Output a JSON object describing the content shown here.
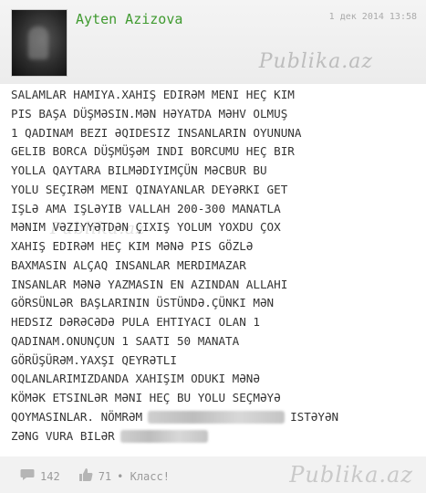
{
  "post": {
    "author": "Ayten Azizova",
    "date": "1 дек 2014 13:58",
    "watermark": "Publika.az",
    "lines": [
      "SALAMLAR HAMIYA.XAHIŞ EDIRƏM MENI HEÇ KIM",
      "PIS BAŞA DÜŞMƏSIN.MƏN HƏYATDA MƏHV OLMUŞ",
      "1 QADINAM BEZI ƏQIDESIZ INSANLARIN OYUNUNA",
      "GELIB BORCA DÜŞMÜŞƏM INDI BORCUMU HEÇ BIR",
      "YOLLA QAYTARA BILMƏDIYIMÇÜN MƏCBUR BU",
      "YOLU SEÇIRƏM MENI QINAYANLAR DEYƏRKI GET",
      "IŞLƏ AMA IŞLƏYIB VALLAH 200-300 MANATLA",
      "MƏNIM VƏZIYYƏTDƏN ÇIXIŞ YOLUM YOXDU ÇOX",
      "XAHIŞ EDIRƏM HEÇ KIM MƏNƏ PIS GÖZLƏ",
      "BAXMASIN ALÇAQ INSANLAR MERDIMAZAR",
      "INSANLAR MƏNƏ YAZMASIN EN AZINDAN ALLAHI",
      "GÖRSÜNLƏR BAŞLARININ ÜSTÜNDƏ.ÇÜNKI MƏN",
      "HEDSIZ DƏRƏCƏDƏ PULA EHTIYACI OLAN 1",
      "QADINAM.ONUNÇUN 1 SAATI 50 MANATA",
      "GÖRÜŞÜRƏM.YAXŞI QEYRƏTLI",
      "OQLANLARIMIZDANDA XAHIŞIM ODUKI MƏNƏ",
      "KÖMƏK ETSINLƏR MƏNI HEÇ BU YOLU SEÇMƏYƏ",
      "QOYMASINLAR. NÖMRƏM"
    ],
    "line_after_phone": "ISTƏYƏN",
    "last_line": "ZƏNG VURA BILƏR"
  },
  "footer": {
    "comments_count": "142",
    "likes_count": "71",
    "class_label": "• Класс!"
  },
  "icons": {
    "comment": "comment-icon",
    "like": "thumbs-up-icon"
  }
}
